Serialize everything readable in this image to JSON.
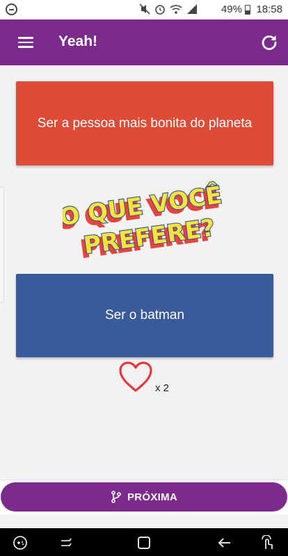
{
  "status_bar": {
    "battery_percent": "49%",
    "time": "18:58"
  },
  "app_bar": {
    "title": "Yeah!",
    "menu_icon": "menu-icon",
    "refresh_icon": "refresh-icon"
  },
  "question": {
    "option_a": "Ser a pessoa mais bonita do planeta",
    "headline_line1": "O QUE VOCÊ",
    "headline_line2": "PREFERE?",
    "option_b": "Ser o batman"
  },
  "likes": {
    "icon": "heart-outline-icon",
    "count_label": "x 2"
  },
  "next_button": {
    "label": "PRÓXIMA",
    "icon": "branch-icon"
  },
  "colors": {
    "primary": "#7b2b8c",
    "option_a_bg": "#de4c38",
    "option_b_bg": "#395a9b",
    "headline_fill": "#f7e53b",
    "headline_shadow": "#e8433c",
    "headline_outline": "#2d4f9e",
    "heart": "#e0393f"
  }
}
